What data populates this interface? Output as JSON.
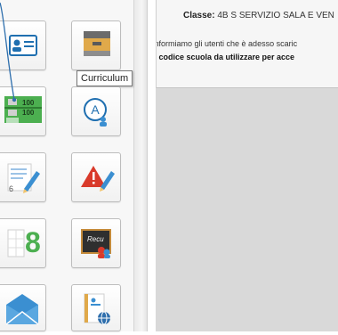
{
  "tooltip": {
    "text": "Curriculum"
  },
  "notice": {
    "class_label": "Classe:",
    "class_value": "4B S SERVIZIO SALA E VEN",
    "info_text": "Informiamo gli utenti che è adesso scaric",
    "code_text": "Il codice scuola da utilizzare per acce"
  },
  "tiles": {
    "grade_values": [
      "100",
      "100"
    ],
    "number_value": "8",
    "slate_text": "Recu"
  },
  "colors": {
    "accent_blue": "#1f6fb0",
    "green": "#4caf50",
    "red": "#d93a2b"
  }
}
